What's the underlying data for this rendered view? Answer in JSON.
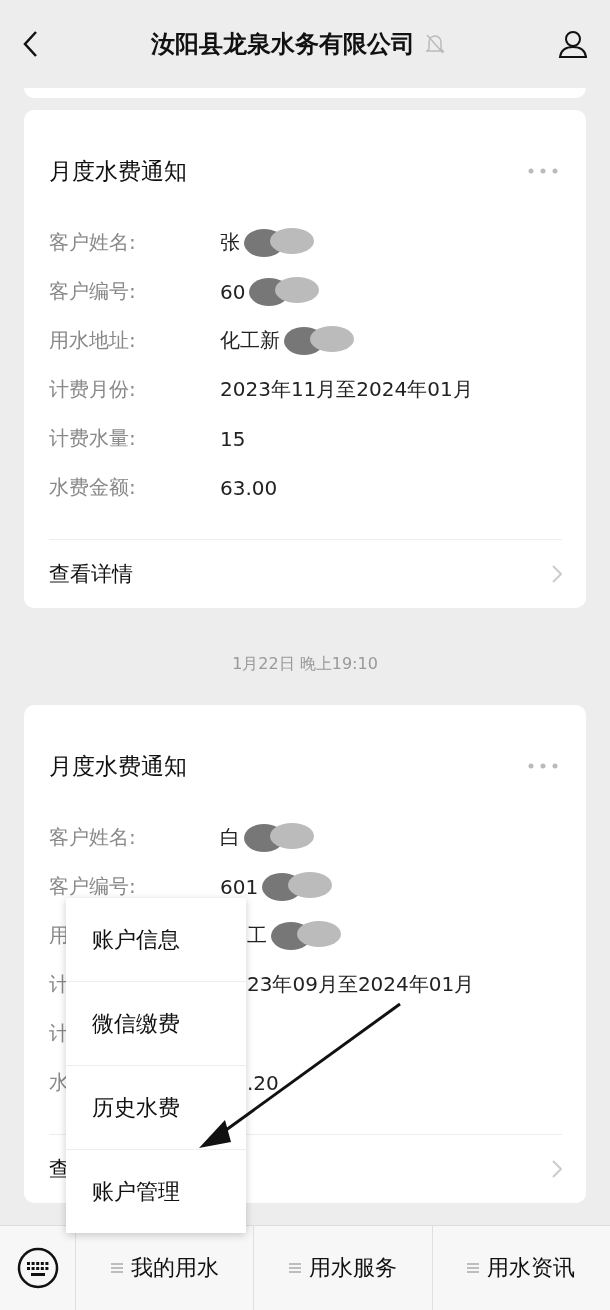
{
  "header": {
    "title": "汝阳县龙泉水务有限公司"
  },
  "messages": [
    {
      "title": "月度水费通知",
      "fields": [
        {
          "label": "客户姓名:",
          "value": "张",
          "redacted": true
        },
        {
          "label": "客户编号:",
          "value": "60",
          "redacted": true
        },
        {
          "label": "用水地址:",
          "value": "化工新",
          "redacted": true
        },
        {
          "label": "计费月份:",
          "value": "2023年11月至2024年01月",
          "redacted": false
        },
        {
          "label": "计费水量:",
          "value": "15",
          "redacted": false
        },
        {
          "label": "水费金额:",
          "value": "63.00",
          "redacted": false
        }
      ],
      "footer": "查看详情"
    },
    {
      "time": "1月22日 晚上19:10",
      "title": "月度水费通知",
      "fields": [
        {
          "label": "客户姓名:",
          "value": "白",
          "redacted": true
        },
        {
          "label": "客户编号:",
          "value": "601",
          "redacted": true
        },
        {
          "label": "用",
          "value": "工",
          "redacted": true,
          "kind": "covered"
        },
        {
          "label": "计",
          "value": "23年09月至2024年01月",
          "redacted": false,
          "kind": "covered"
        },
        {
          "label": "计",
          "redacted": false
        },
        {
          "label": "水",
          "value": ".20",
          "redacted": false,
          "kind": "covered"
        }
      ],
      "footer": "查"
    }
  ],
  "popup_menu": [
    "账户信息",
    "微信缴费",
    "历史水费",
    "账户管理"
  ],
  "menu_bar": [
    "我的用水",
    "用水服务",
    "用水资讯"
  ]
}
